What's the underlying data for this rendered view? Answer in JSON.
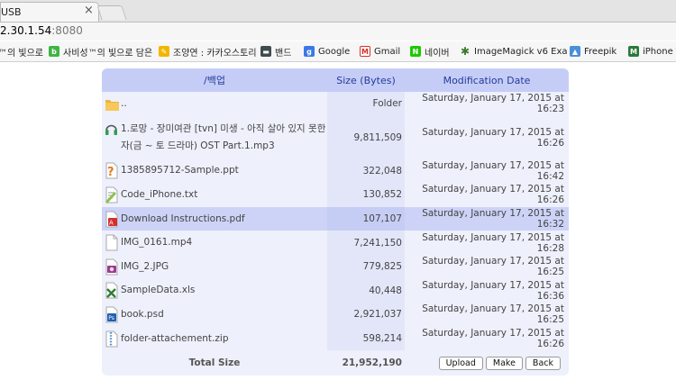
{
  "browser": {
    "tab_title": "USB",
    "tab_close": "×",
    "url_host": "2.30.1.54",
    "url_port": ":8080",
    "bookmarks": [
      {
        "label": "™의 빛으로",
        "icon": "bookmark-icon",
        "color": "#8c8c8c"
      },
      {
        "label": "사비성™의 빛으로 담은",
        "icon": "blog-icon",
        "color": "#3fb445"
      },
      {
        "label": "조양연 : 카카오스토리",
        "icon": "kakaostory-icon",
        "color": "#f2b600"
      },
      {
        "label": "밴드",
        "icon": "band-icon",
        "color": "#3e4b4f"
      },
      {
        "label": "Google",
        "icon": "google-icon",
        "color": "#3b78e7"
      },
      {
        "label": "Gmail",
        "icon": "gmail-icon",
        "color": "#d93025"
      },
      {
        "label": "네이버",
        "icon": "naver-icon",
        "color": "#1ec800"
      },
      {
        "label": "ImageMagick v6 Exa",
        "icon": "imagemagick-icon",
        "color": "#3a7a2a"
      },
      {
        "label": "Freepik",
        "icon": "freepik-icon",
        "color": "#4a8fd9"
      },
      {
        "label": "iPhone T",
        "icon": "iphone-icon",
        "color": "#2a7a3a"
      }
    ]
  },
  "table": {
    "headers": {
      "name": "/백업",
      "size": "Size (Bytes)",
      "date": "Modification Date"
    },
    "rows": [
      {
        "name": "..",
        "size": "Folder",
        "date": "Saturday, January 17, 2015 at 16:23",
        "icon": "folder-icon"
      },
      {
        "name": "1.로망 - 장미여관 [tvn] 미생 - 아직 살아 있지 못한 자(금 ~ 토 드라마) OST Part.1.mp3",
        "size": "9,811,509",
        "date": "Saturday, January 17, 2015 at 16:26",
        "icon": "audio-file-icon"
      },
      {
        "name": "1385895712-Sample.ppt",
        "size": "322,048",
        "date": "Saturday, January 17, 2015 at 16:42",
        "icon": "presentation-file-icon"
      },
      {
        "name": "Code_iPhone.txt",
        "size": "130,852",
        "date": "Saturday, January 17, 2015 at 16:26",
        "icon": "text-file-icon"
      },
      {
        "name": "Download Instructions.pdf",
        "size": "107,107",
        "date": "Saturday, January 17, 2015 at 16:32",
        "icon": "pdf-file-icon"
      },
      {
        "name": "IMG_0161.mp4",
        "size": "7,241,150",
        "date": "Saturday, January 17, 2015 at 16:28",
        "icon": "video-file-icon"
      },
      {
        "name": "IMG_2.JPG",
        "size": "779,825",
        "date": "Saturday, January 17, 2015 at 16:25",
        "icon": "image-file-icon"
      },
      {
        "name": "SampleData.xls",
        "size": "40,448",
        "date": "Saturday, January 17, 2015 at 16:36",
        "icon": "spreadsheet-file-icon"
      },
      {
        "name": "book.psd",
        "size": "2,921,037",
        "date": "Saturday, January 17, 2015 at 16:25",
        "icon": "photoshop-file-icon"
      },
      {
        "name": "folder-attachement.zip",
        "size": "598,214",
        "date": "Saturday, January 17, 2015 at 16:26",
        "icon": "archive-file-icon"
      }
    ],
    "footer": {
      "label": "Total Size",
      "total": "21,952,190"
    },
    "buttons": {
      "upload": "Upload",
      "make": "Make",
      "back": "Back"
    }
  }
}
